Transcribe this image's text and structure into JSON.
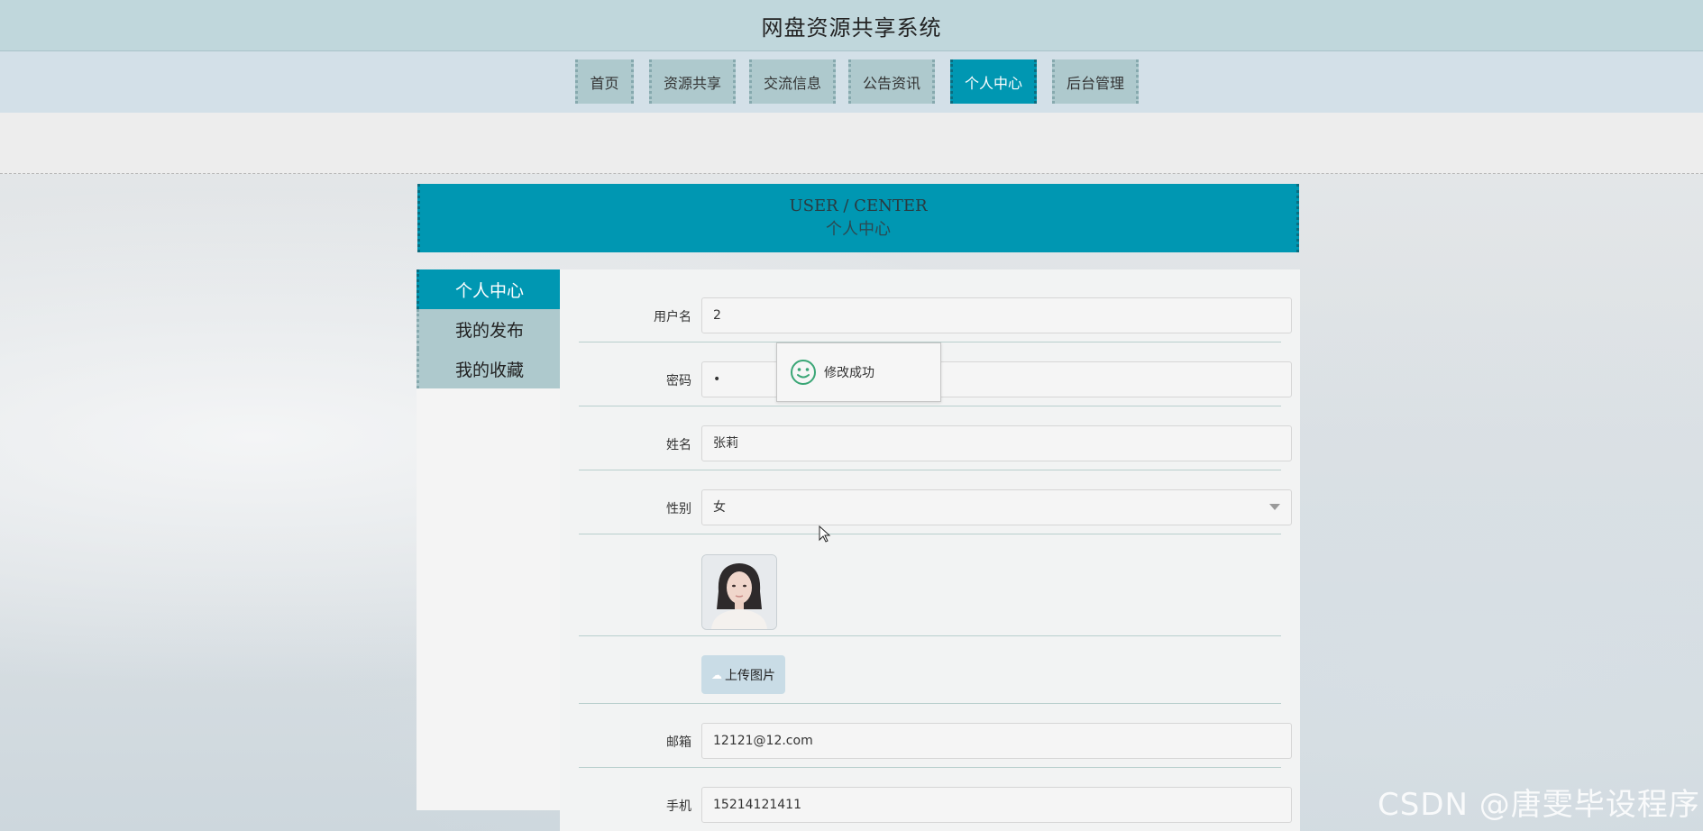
{
  "app_title": "网盘资源共享系统",
  "nav": [
    {
      "label": "首页",
      "active": false
    },
    {
      "label": "资源共享",
      "active": false
    },
    {
      "label": "交流信息",
      "active": false
    },
    {
      "label": "公告资讯",
      "active": false
    },
    {
      "label": "个人中心",
      "active": true
    },
    {
      "label": "后台管理",
      "active": false
    }
  ],
  "banner": {
    "en": "USER / CENTER",
    "cn": "个人中心"
  },
  "menu": [
    {
      "label": "个人中心",
      "active": true
    },
    {
      "label": "我的发布",
      "active": false
    },
    {
      "label": "我的收藏",
      "active": false
    }
  ],
  "form": {
    "username": {
      "label": "用户名",
      "value": "2"
    },
    "password": {
      "label": "密码",
      "value": "•"
    },
    "name": {
      "label": "姓名",
      "value": "张莉"
    },
    "gender": {
      "label": "性别",
      "value": "女"
    },
    "upload_label": "上传图片",
    "email": {
      "label": "邮箱",
      "value": "12121@12.com"
    },
    "phone": {
      "label": "手机",
      "value": "15214121411"
    }
  },
  "toast": {
    "message": "修改成功",
    "icon": "smile-icon"
  },
  "watermark": "CSDN @唐雯毕设程序",
  "colors": {
    "accent": "#0097b2",
    "nav_bg": "#aec9cd",
    "topbar": "#c0d7dc"
  }
}
